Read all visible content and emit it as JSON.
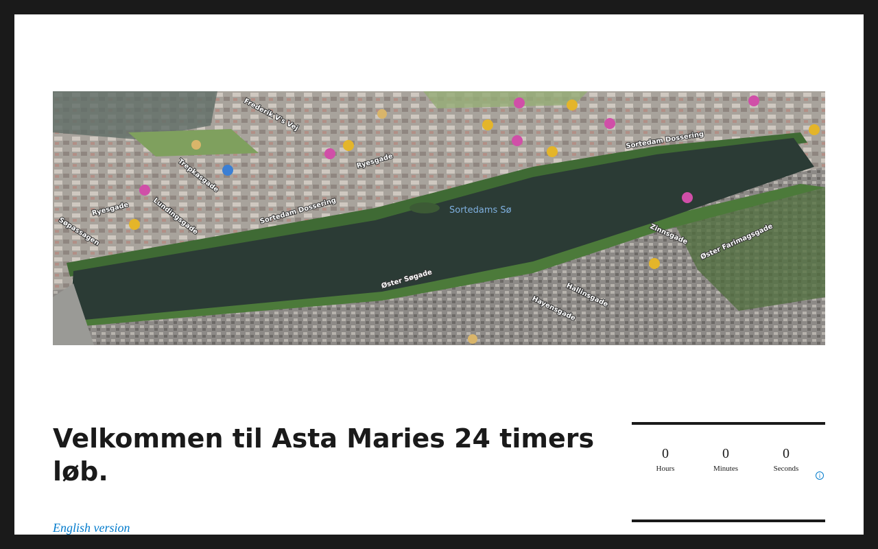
{
  "hero": {
    "lake_label": "Sortedams Sø",
    "street_labels": [
      "Frederik V's Vej",
      "Trepkasgade",
      "Ryesgade",
      "Ryesgade",
      "Lundingsgade",
      "Søpassagen",
      "Sortedam Dossering",
      "Sortedam Dossering",
      "Zinnsgade",
      "Øster Farimagsgade",
      "Øster Søgade",
      "Hallinsgade",
      "Hayensgade"
    ]
  },
  "page": {
    "title": "Velkommen til Asta Maries 24 timers løb.",
    "english_link": "English version"
  },
  "countdown": {
    "hours": {
      "value": "0",
      "label": "Hours"
    },
    "minutes": {
      "value": "0",
      "label": "Minutes"
    },
    "seconds": {
      "value": "0",
      "label": "Seconds"
    },
    "info_symbol": "i"
  },
  "colors": {
    "frame": "#1a1a1a",
    "link": "#007acc",
    "lake": "#2b3b35"
  }
}
